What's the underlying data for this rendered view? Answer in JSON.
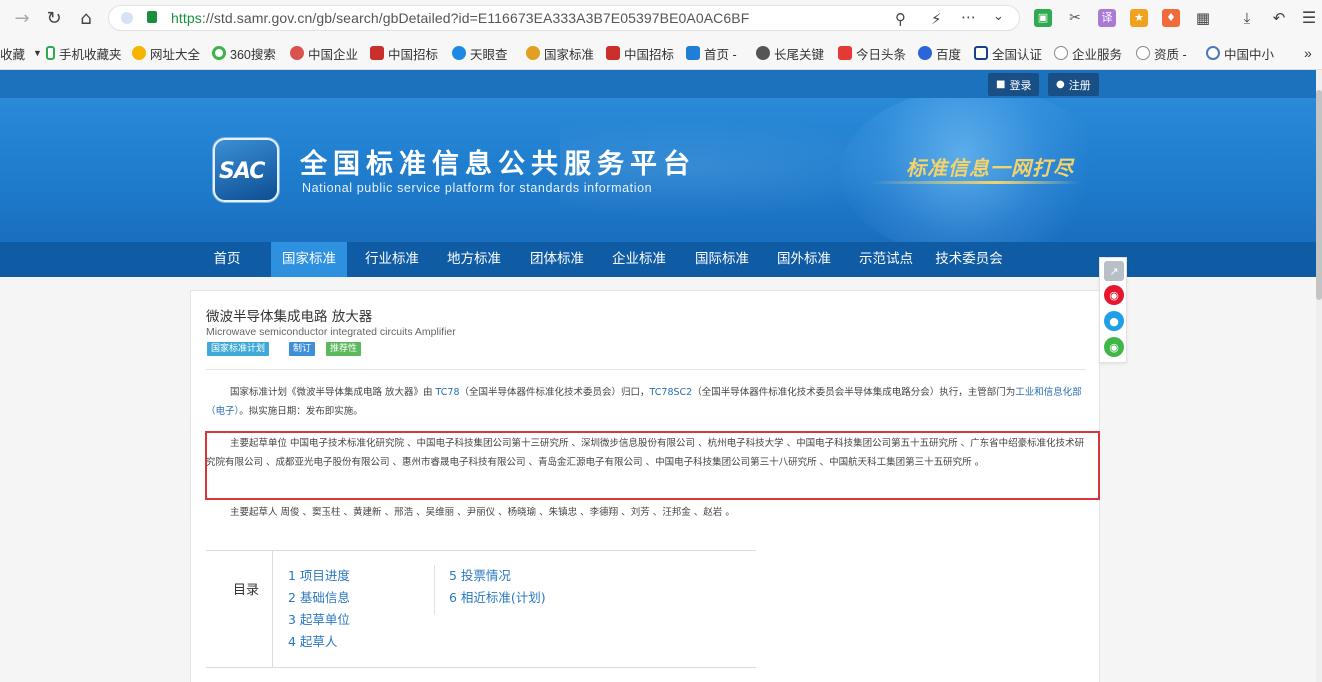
{
  "browser": {
    "url_scheme": "https",
    "url_rest": "://std.samr.gov.cn/gb/search/gbDetailed?id=E116673EA333A3B7E05397BE0A0AC6BF"
  },
  "bookmarks": {
    "overflow_label": "收藏",
    "items": [
      "手机收藏夹",
      "网址大全",
      "360搜索",
      "中国企业",
      "中国招标",
      "天眼查",
      "国家标准",
      "中国招标",
      "首页 -",
      "长尾关键",
      "今日头条",
      "百度",
      "全国认证",
      "企业服务",
      "资质 -",
      "中国中小"
    ]
  },
  "header": {
    "login_label": "登录",
    "register_label": "注册",
    "logo_text": "SAC",
    "site_title": "全国标准信息公共服务平台",
    "site_subtitle": "National public service platform  for standards information",
    "slogan": "标准信息一网打尽"
  },
  "nav": {
    "items": [
      "首页",
      "国家标准",
      "行业标准",
      "地方标准",
      "团体标准",
      "企业标准",
      "国际标准",
      "国外标准",
      "示范试点",
      "技术委员会"
    ],
    "active": "国家标准"
  },
  "standard": {
    "title_cn": "微波半导体集成电路 放大器",
    "title_en": "Microwave semiconductor integrated circuits Amplifier",
    "tags": [
      {
        "label": "国家标准计划",
        "color": "#3fa9d8"
      },
      {
        "label": "制订",
        "color": "#3f8fd8"
      },
      {
        "label": "推荐性",
        "color": "#5cb85c"
      }
    ]
  },
  "description": {
    "p1_a": "国家标准计划《微波半导体集成电路 放大器》由 ",
    "p1_tc": "TC78",
    "p1_b": "（全国半导体器件标准化技术委员会）归口，",
    "p1_sc": "TC78SC2",
    "p1_c": "（全国半导体器件标准化技术委员会半导体集成电路分会）执行，主管部门为",
    "p1_dept": "工业和信息化部（电子）",
    "p1_d": "。拟实施日期：发布即实施。",
    "p2": "主要起草单位 中国电子技术标准化研究院 、中国电子科技集团公司第十三研究所 、深圳微步信息股份有限公司 、杭州电子科技大学 、中国电子科技集团公司第五十五研究所 、广东省中绍豪标准化技术研究院有限公司 、成都亚光电子股份有限公司 、惠州市睿晟电子科技有限公司 、青岛金汇源电子有限公司 、中国电子科技集团公司第三十八研究所 、中国航天科工集团第三十五研究所 。",
    "p3": "主要起草人 周俊 、窦玉柱 、黄建新 、邢浩 、吴维丽 、尹丽仪 、杨晓瑜 、朱镇忠 、李德翔 、刘芳 、汪邦金 、赵岩 。"
  },
  "toc": {
    "label": "目录",
    "items": [
      "1  项目进度",
      "2  基础信息",
      "3  起草单位",
      "4  起草人",
      "5  投票情况",
      "6  相近标准(计划)"
    ]
  },
  "share": {
    "icons": [
      "share-icon",
      "weibo-icon",
      "qq-icon",
      "wechat-icon"
    ]
  }
}
